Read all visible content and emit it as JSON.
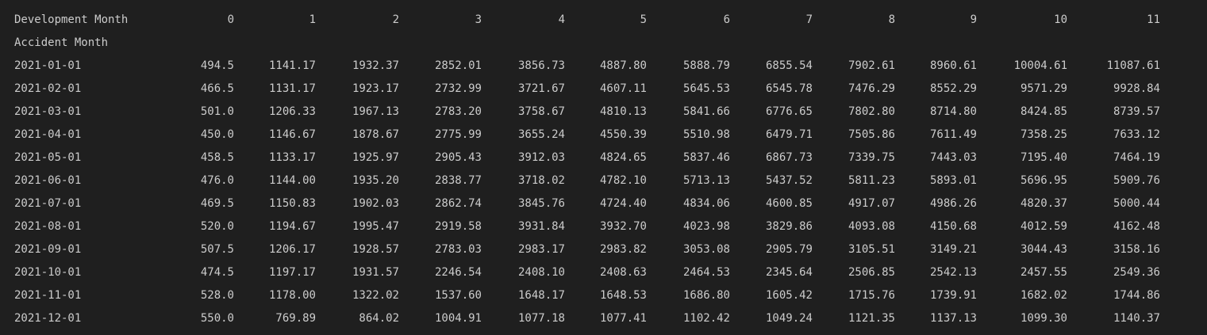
{
  "table": {
    "columns_name": "Development Month",
    "index_name": "Accident Month",
    "columns": [
      "0",
      "1",
      "2",
      "3",
      "4",
      "5",
      "6",
      "7",
      "8",
      "9",
      "10",
      "11"
    ],
    "rows": [
      {
        "index": "2021-01-01",
        "values": [
          "494.5",
          "1141.17",
          "1932.37",
          "2852.01",
          "3856.73",
          "4887.80",
          "5888.79",
          "6855.54",
          "7902.61",
          "8960.61",
          "10004.61",
          "11087.61"
        ]
      },
      {
        "index": "2021-02-01",
        "values": [
          "466.5",
          "1131.17",
          "1923.17",
          "2732.99",
          "3721.67",
          "4607.11",
          "5645.53",
          "6545.78",
          "7476.29",
          "8552.29",
          "9571.29",
          "9928.84"
        ]
      },
      {
        "index": "2021-03-01",
        "values": [
          "501.0",
          "1206.33",
          "1967.13",
          "2783.20",
          "3758.67",
          "4810.13",
          "5841.66",
          "6776.65",
          "7802.80",
          "8714.80",
          "8424.85",
          "8739.57"
        ]
      },
      {
        "index": "2021-04-01",
        "values": [
          "450.0",
          "1146.67",
          "1878.67",
          "2775.99",
          "3655.24",
          "4550.39",
          "5510.98",
          "6479.71",
          "7505.86",
          "7611.49",
          "7358.25",
          "7633.12"
        ]
      },
      {
        "index": "2021-05-01",
        "values": [
          "458.5",
          "1133.17",
          "1925.97",
          "2905.43",
          "3912.03",
          "4824.65",
          "5837.46",
          "6867.73",
          "7339.75",
          "7443.03",
          "7195.40",
          "7464.19"
        ]
      },
      {
        "index": "2021-06-01",
        "values": [
          "476.0",
          "1144.00",
          "1935.20",
          "2838.77",
          "3718.02",
          "4782.10",
          "5713.13",
          "5437.52",
          "5811.23",
          "5893.01",
          "5696.95",
          "5909.76"
        ]
      },
      {
        "index": "2021-07-01",
        "values": [
          "469.5",
          "1150.83",
          "1902.03",
          "2862.74",
          "3845.76",
          "4724.40",
          "4834.06",
          "4600.85",
          "4917.07",
          "4986.26",
          "4820.37",
          "5000.44"
        ]
      },
      {
        "index": "2021-08-01",
        "values": [
          "520.0",
          "1194.67",
          "1995.47",
          "2919.58",
          "3931.84",
          "3932.70",
          "4023.98",
          "3829.86",
          "4093.08",
          "4150.68",
          "4012.59",
          "4162.48"
        ]
      },
      {
        "index": "2021-09-01",
        "values": [
          "507.5",
          "1206.17",
          "1928.57",
          "2783.03",
          "2983.17",
          "2983.82",
          "3053.08",
          "2905.79",
          "3105.51",
          "3149.21",
          "3044.43",
          "3158.16"
        ]
      },
      {
        "index": "2021-10-01",
        "values": [
          "474.5",
          "1197.17",
          "1931.57",
          "2246.54",
          "2408.10",
          "2408.63",
          "2464.53",
          "2345.64",
          "2506.85",
          "2542.13",
          "2457.55",
          "2549.36"
        ]
      },
      {
        "index": "2021-11-01",
        "values": [
          "528.0",
          "1178.00",
          "1322.02",
          "1537.60",
          "1648.17",
          "1648.53",
          "1686.80",
          "1605.42",
          "1715.76",
          "1739.91",
          "1682.02",
          "1744.86"
        ]
      },
      {
        "index": "2021-12-01",
        "values": [
          "550.0",
          "769.89",
          "864.02",
          "1004.91",
          "1077.18",
          "1077.41",
          "1102.42",
          "1049.24",
          "1121.35",
          "1137.13",
          "1099.30",
          "1140.37"
        ]
      }
    ]
  }
}
